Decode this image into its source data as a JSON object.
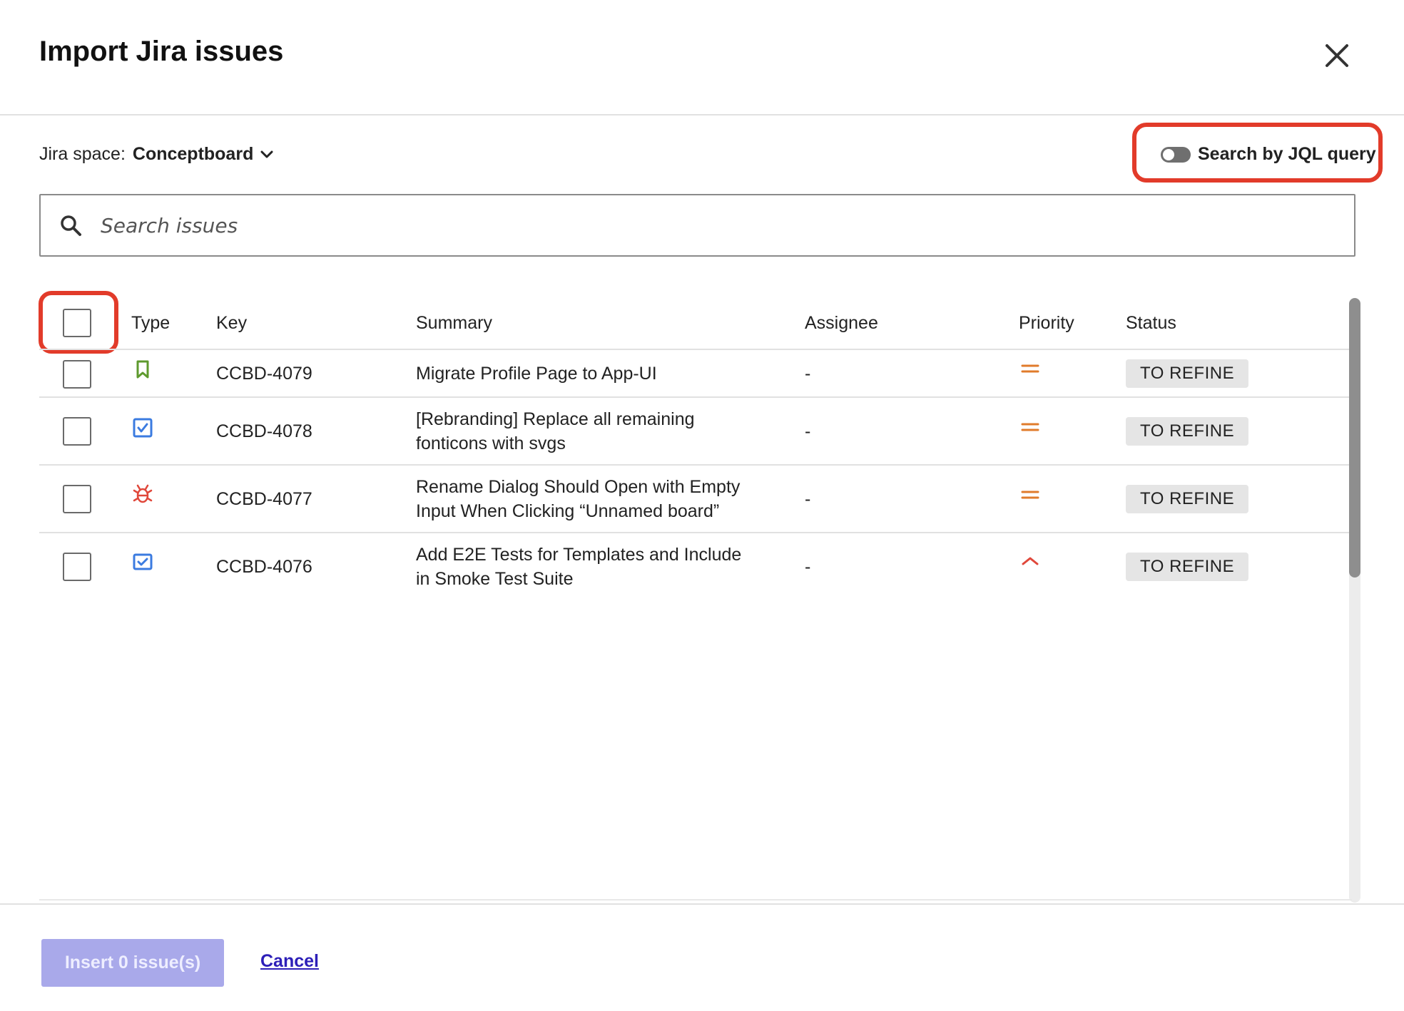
{
  "dialog": {
    "title": "Import Jira issues",
    "close_icon": "close-icon"
  },
  "space": {
    "label": "Jira space:",
    "value": "Conceptboard"
  },
  "jql": {
    "label": "Search by JQL query",
    "enabled": false
  },
  "search": {
    "placeholder": "Search issues"
  },
  "table": {
    "headers": {
      "type": "Type",
      "key": "Key",
      "summary": "Summary",
      "assignee": "Assignee",
      "priority": "Priority",
      "status": "Status"
    },
    "rows": [
      {
        "type_icon": "bookmark-icon",
        "key": "CCBD-4079",
        "summary_line1": "Migrate Profile Page to App-UI",
        "summary_line2": "",
        "assignee": "-",
        "priority_icon": "priority-medium-icon",
        "status": "TO REFINE"
      },
      {
        "type_icon": "task-checkbox-icon",
        "key": "CCBD-4078",
        "summary_line1": "[Rebranding] Replace all remaining",
        "summary_line2": "fonticons with svgs",
        "assignee": "-",
        "priority_icon": "priority-medium-icon",
        "status": "TO REFINE"
      },
      {
        "type_icon": "bug-icon",
        "key": "CCBD-4077",
        "summary_line1": "Rename Dialog Should Open with Empty",
        "summary_line2": "Input When Clicking “Unnamed board”",
        "assignee": "-",
        "priority_icon": "priority-medium-icon",
        "status": "TO REFINE"
      },
      {
        "type_icon": "subtask-checkbox-icon",
        "key": "CCBD-4076",
        "summary_line1": "Add E2E Tests for Templates and Include",
        "summary_line2": "in Smoke Test Suite",
        "assignee": "-",
        "priority_icon": "priority-high-icon",
        "status": "TO REFINE"
      }
    ]
  },
  "footer": {
    "insert_label": "Insert 0 issue(s)",
    "cancel_label": "Cancel"
  },
  "colors": {
    "accent": "#2d1fb8",
    "insert_disabled": "#a9a9ea",
    "highlight": "#e23b2a",
    "priority_medium": "#e07b2b",
    "priority_high": "#e0473a",
    "story_green": "#5e9a2e",
    "task_blue": "#3b7be0",
    "bug_red": "#e0473a"
  }
}
